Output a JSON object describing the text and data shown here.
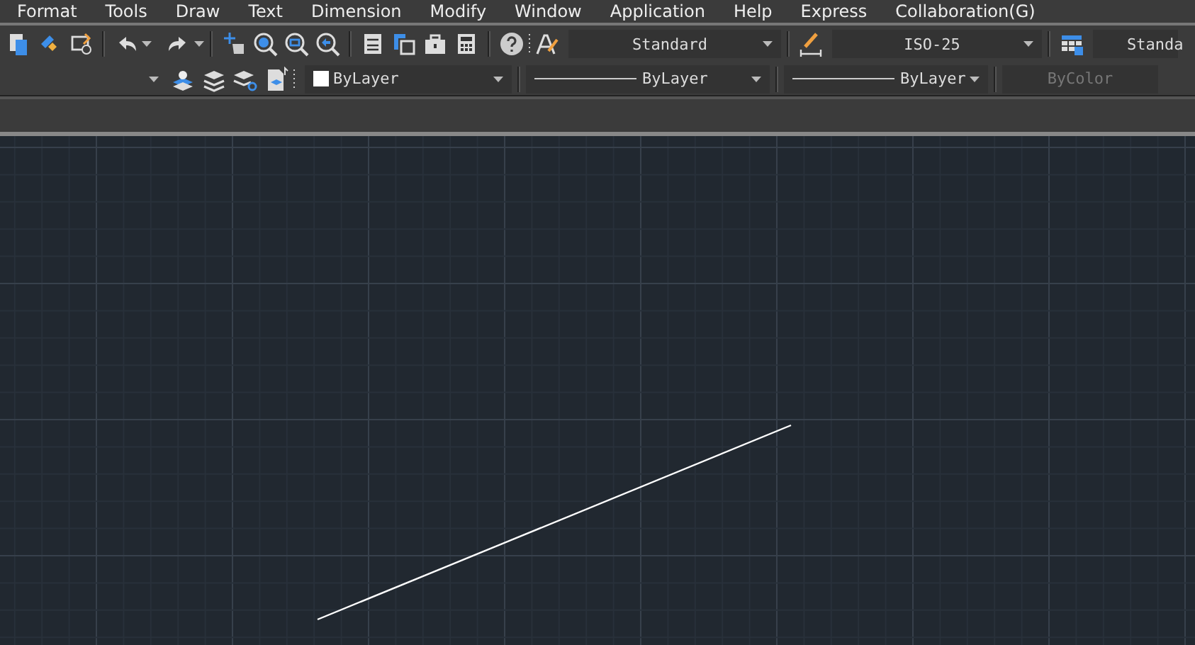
{
  "menu": [
    "Format",
    "Tools",
    "Draw",
    "Text",
    "Dimension",
    "Modify",
    "Window",
    "Application",
    "Help",
    "Express",
    "Collaboration(G)"
  ],
  "styles_toolbar": {
    "text_style": "Standard",
    "dimension_style": "ISO-25",
    "table_style": "Standa"
  },
  "properties_toolbar": [
    {
      "kind": "layer"
    },
    {
      "kind": "color",
      "label": "ByLayer",
      "color": "#ffffff",
      "disabled": false
    },
    {
      "kind": "linetype",
      "label": "ByLayer",
      "disabled": false
    },
    {
      "kind": "lineweight",
      "label": "ByLayer",
      "disabled": false
    },
    {
      "kind": "plotstyle",
      "label": "ByColor",
      "disabled": true
    }
  ]
}
